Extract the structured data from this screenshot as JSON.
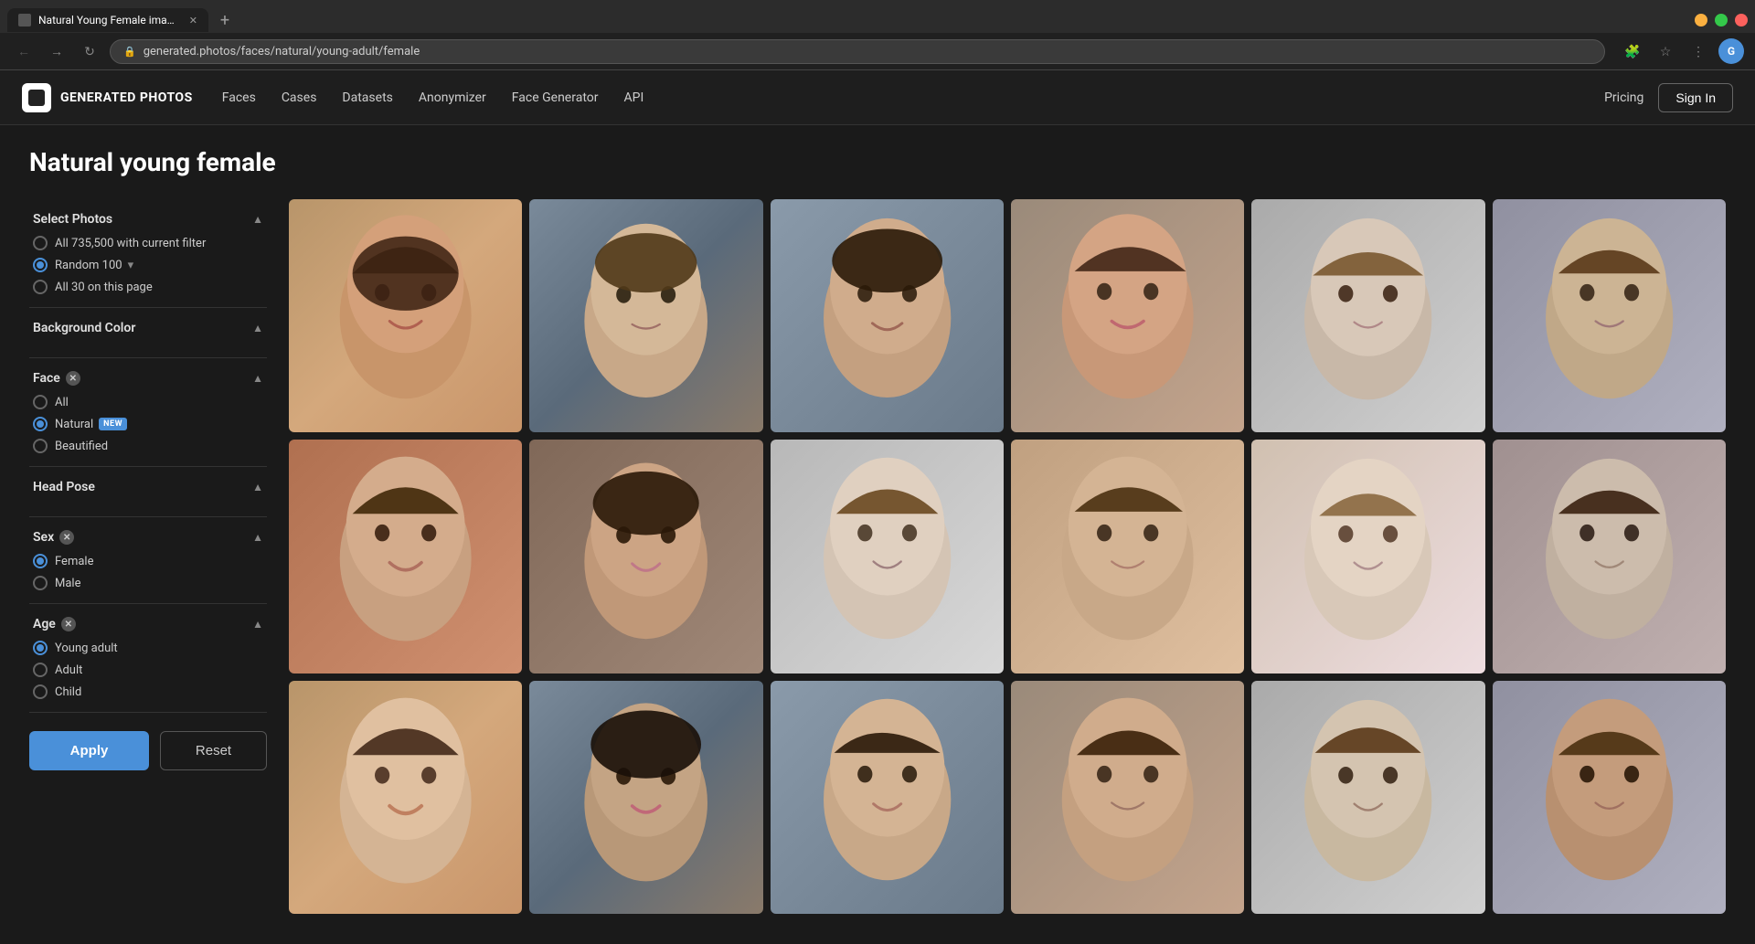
{
  "browser": {
    "tab_title": "Natural Young Female images |",
    "url": "generated.photos/faces/natural/young-adult/female",
    "favicon": "gp"
  },
  "nav": {
    "brand_name": "GENERATED PHOTOS",
    "links": [
      "Faces",
      "Cases",
      "Datasets",
      "Anonymizer",
      "Face Generator",
      "API"
    ],
    "pricing_label": "Pricing",
    "signin_label": "Sign In"
  },
  "page": {
    "title": "Natural young female"
  },
  "sidebar": {
    "select_photos_label": "Select Photos",
    "select_options": [
      "All 735,500 with current filter",
      "Random 100",
      "All 30 on this page"
    ],
    "background_color_label": "Background Color",
    "face_label": "Face",
    "face_options": [
      {
        "label": "All",
        "selected": false
      },
      {
        "label": "Natural",
        "selected": true,
        "badge": "NEW"
      },
      {
        "label": "Beautified",
        "selected": false
      }
    ],
    "head_pose_label": "Head Pose",
    "sex_label": "Sex",
    "sex_options": [
      {
        "label": "Female",
        "selected": true
      },
      {
        "label": "Male",
        "selected": false
      }
    ],
    "age_label": "Age",
    "age_options": [
      {
        "label": "Young adult",
        "selected": true
      },
      {
        "label": "Adult",
        "selected": false
      },
      {
        "label": "Child",
        "selected": false
      }
    ],
    "apply_label": "Apply",
    "reset_label": "Reset"
  },
  "photos": {
    "faces": [
      {
        "id": 1,
        "bg": "face-bg-1",
        "row": 1
      },
      {
        "id": 2,
        "bg": "face-bg-2",
        "row": 1
      },
      {
        "id": 3,
        "bg": "face-bg-3",
        "row": 1
      },
      {
        "id": 4,
        "bg": "face-bg-4",
        "row": 1
      },
      {
        "id": 5,
        "bg": "face-bg-5",
        "row": 1
      },
      {
        "id": 6,
        "bg": "face-bg-6",
        "row": 1
      },
      {
        "id": 7,
        "bg": "face-bg-7",
        "row": 2
      },
      {
        "id": 8,
        "bg": "face-bg-8",
        "row": 2
      },
      {
        "id": 9,
        "bg": "face-bg-9",
        "row": 2
      },
      {
        "id": 10,
        "bg": "face-bg-10",
        "row": 2
      },
      {
        "id": 11,
        "bg": "face-bg-11",
        "row": 2
      },
      {
        "id": 12,
        "bg": "face-bg-12",
        "row": 2
      },
      {
        "id": 13,
        "bg": "face-bg-1",
        "row": 3
      },
      {
        "id": 14,
        "bg": "face-bg-2",
        "row": 3
      },
      {
        "id": 15,
        "bg": "face-bg-3",
        "row": 3
      },
      {
        "id": 16,
        "bg": "face-bg-4",
        "row": 3
      },
      {
        "id": 17,
        "bg": "face-bg-5",
        "row": 3
      },
      {
        "id": 18,
        "bg": "face-bg-6",
        "row": 3
      }
    ]
  }
}
